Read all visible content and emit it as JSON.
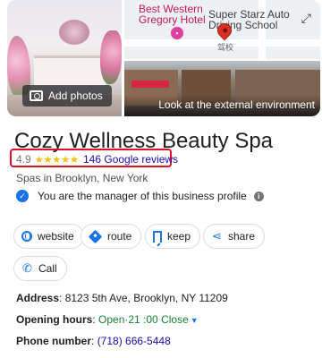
{
  "photos": {
    "add_photos_label": "Add photos",
    "map_label_1": "Best Western Gregory Hotel",
    "map_label_1_line1": "Best Western",
    "map_label_1_line2": "Gregory Hotel",
    "map_label_2_line1": "Super Starz Auto",
    "map_label_2_line2": "Driving School",
    "map_label_cn": "驾校",
    "street_view_label": "Look at the external environment"
  },
  "business": {
    "name": "Cozy Wellness Beauty Spa",
    "rating": "4.9",
    "stars": "★★★★★",
    "reviews_link": "146 Google reviews",
    "category": "Spas in Brooklyn, New York",
    "manager_text": "You are the manager of this business profile"
  },
  "actions": {
    "website": "website",
    "route": "route",
    "keep": "keep",
    "share": "share",
    "call": "Call"
  },
  "details": {
    "address_label": "Address",
    "address_value": ": 8123 5th Ave, Brooklyn, NY 11209",
    "hours_label": "Opening hours",
    "hours_sep": ": ",
    "hours_open": "Open",
    "hours_time": "·21 :00 Close",
    "phone_label": "Phone number",
    "phone_sep": ": ",
    "phone_value": "(718) 666-5448"
  },
  "colors": {
    "accent": "#1a73e8",
    "link": "#1a0dab",
    "star": "#fbbc04",
    "open": "#188038",
    "highlight_border": "#e0102b"
  },
  "icons": {
    "camera": "camera-icon",
    "expand": "expand-icon",
    "verified": "verified-check-icon",
    "info": "info-icon",
    "website": "globe-icon",
    "route": "directions-icon",
    "keep": "bookmark-icon",
    "share": "share-icon",
    "call": "phone-icon",
    "hours_dropdown": "chevron-down-icon"
  }
}
